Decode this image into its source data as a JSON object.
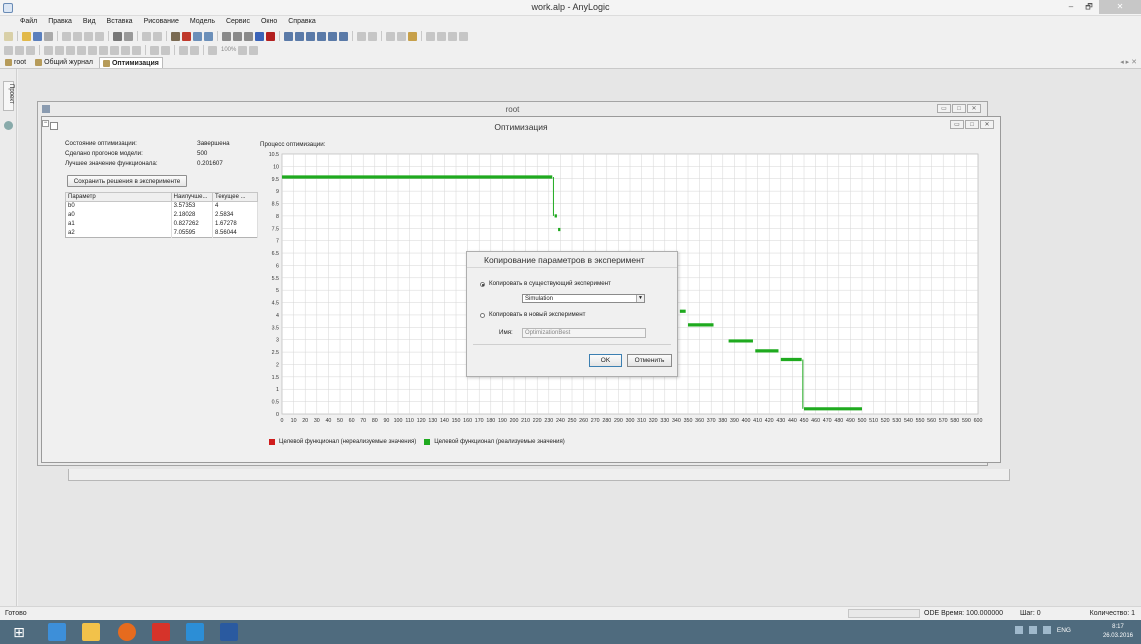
{
  "window": {
    "title": "work.alp - AnyLogic",
    "min": "–",
    "max": "🗗",
    "close": "✕"
  },
  "menu": [
    "Файл",
    "Правка",
    "Вид",
    "Вставка",
    "Рисование",
    "Модель",
    "Сервис",
    "Окно",
    "Справка"
  ],
  "toolbar2": {
    "zoom": "100%"
  },
  "left_strip": {
    "tab_label": "Проект"
  },
  "tabs": [
    {
      "label": "root"
    },
    {
      "label": "Общий журнал"
    },
    {
      "label": "Оптимизация"
    }
  ],
  "root_window": {
    "title": "root"
  },
  "opt_window": {
    "title": "Оптимизация",
    "stats": [
      {
        "label": "Состояние оптимизации:",
        "value": "Завершена"
      },
      {
        "label": "Сделано прогонов модели:",
        "value": "500"
      },
      {
        "label": "Лучшее значение функционала:",
        "value": "0.201607"
      }
    ],
    "save_button": "Сохранить решения в эксперименте",
    "table": {
      "headers": [
        "Параметр",
        "Наилучше...",
        "Текущее ..."
      ],
      "rows": [
        [
          "b0",
          "3.57353",
          "4"
        ],
        [
          "a0",
          "2.18028",
          "2.5834"
        ],
        [
          "a1",
          "0.827262",
          "1.67278"
        ],
        [
          "a2",
          "7.05595",
          "8.56044"
        ]
      ]
    },
    "chart_label": "Процесс оптимизации:"
  },
  "chart_data": {
    "type": "scatter",
    "title": "",
    "xlabel": "",
    "ylabel": "",
    "xlim": [
      0,
      600
    ],
    "ylim": [
      0,
      10.5
    ],
    "x_ticks": [
      0,
      10,
      20,
      30,
      40,
      50,
      60,
      70,
      80,
      90,
      100,
      110,
      120,
      130,
      140,
      150,
      160,
      170,
      180,
      190,
      200,
      210,
      220,
      230,
      240,
      250,
      260,
      270,
      280,
      290,
      300,
      310,
      320,
      330,
      340,
      350,
      360,
      370,
      380,
      390,
      400,
      410,
      420,
      430,
      440,
      450,
      460,
      470,
      480,
      490,
      500,
      510,
      520,
      530,
      540,
      550,
      560,
      570,
      580,
      590,
      600
    ],
    "y_ticks": [
      0,
      0.5,
      1,
      1.5,
      2,
      2.5,
      3,
      3.5,
      4,
      4.5,
      5,
      5.5,
      6,
      6.5,
      7,
      7.5,
      8,
      8.5,
      9,
      9.5,
      10,
      10.5
    ],
    "grid": true,
    "legend_position": "bottom",
    "series": [
      {
        "name": "Целевой функционал (нереализуемые значения)",
        "color": "#d01c1c",
        "points": []
      },
      {
        "name": "Целевой функционал (реализуемые значения)",
        "color": "#1faa1f",
        "segments": [
          {
            "x0": 0,
            "x1": 233,
            "y": 9.57
          },
          {
            "x0": 235,
            "x1": 237,
            "y": 8.0
          },
          {
            "x0": 238,
            "x1": 240,
            "y": 7.45
          },
          {
            "x0": 343,
            "x1": 348,
            "y": 4.15
          },
          {
            "x0": 350,
            "x1": 372,
            "y": 3.6
          },
          {
            "x0": 385,
            "x1": 406,
            "y": 2.95
          },
          {
            "x0": 408,
            "x1": 428,
            "y": 2.55
          },
          {
            "x0": 430,
            "x1": 448,
            "y": 2.2
          },
          {
            "x0": 450,
            "x1": 500,
            "y": 0.21
          }
        ],
        "drops": [
          {
            "x": 234,
            "y0": 9.57,
            "y1": 8.0
          },
          {
            "x": 449,
            "y0": 2.2,
            "y1": 0.21
          }
        ]
      }
    ]
  },
  "dialog": {
    "title": "Копирование параметров в эксперимент",
    "opt_existing": "Копировать в существующий эксперимент",
    "select_value": "Simulation",
    "opt_new": "Копировать в новый эксперимент",
    "name_label": "Имя:",
    "name_value": "OptimizationBest",
    "ok": "OK",
    "cancel": "Отменить"
  },
  "status": {
    "left": "Готово",
    "time": "ODE Время: 100.000000",
    "step": "Шаг: 0",
    "count": "Количество: 1"
  },
  "taskbar": {
    "lang": "ENG",
    "time": "8:17",
    "date": "26.03.2016"
  },
  "colors": {
    "taskbar": "#4f6b7e",
    "accent": "#3c7fb1"
  }
}
